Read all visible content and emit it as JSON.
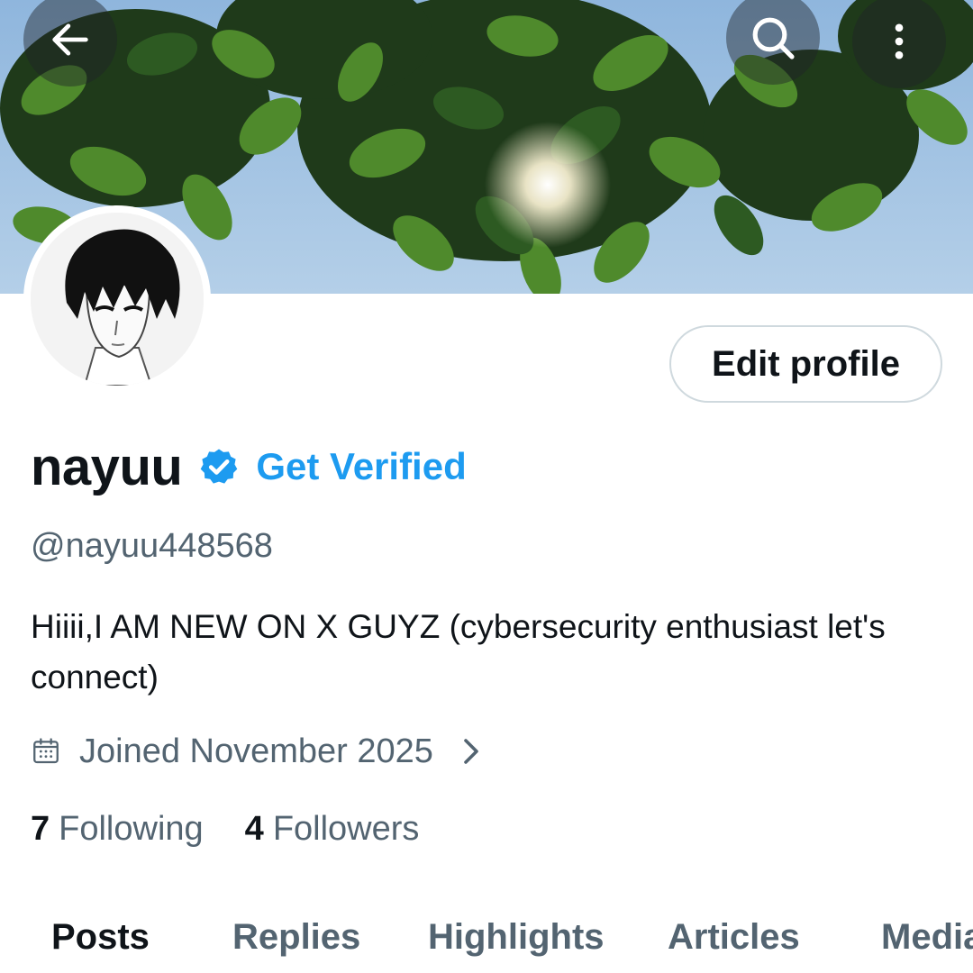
{
  "header": {
    "back_icon": "arrow-left-icon",
    "search_icon": "search-icon",
    "more_icon": "more-vertical-icon"
  },
  "profile": {
    "display_name": "nayuu",
    "verified_icon": "verified-badge-icon",
    "get_verified_label": "Get Verified",
    "handle": "@nayuu448568",
    "bio": "Hiiii,I AM NEW ON X GUYZ (cybersecurity enthusiast let's connect)",
    "joined_icon": "calendar-icon",
    "joined": "Joined November 2025",
    "edit_profile_label": "Edit profile",
    "following_count": "7",
    "following_label": "Following",
    "followers_count": "4",
    "followers_label": "Followers"
  },
  "tabs": [
    {
      "label": "Posts",
      "active": true
    },
    {
      "label": "Replies",
      "active": false
    },
    {
      "label": "Highlights",
      "active": false
    },
    {
      "label": "Articles",
      "active": false
    },
    {
      "label": "Media",
      "active": false
    }
  ],
  "colors": {
    "accent": "#1d9bf0",
    "text_primary": "#0f1419",
    "text_secondary": "#536471",
    "border": "#cfd9de"
  }
}
